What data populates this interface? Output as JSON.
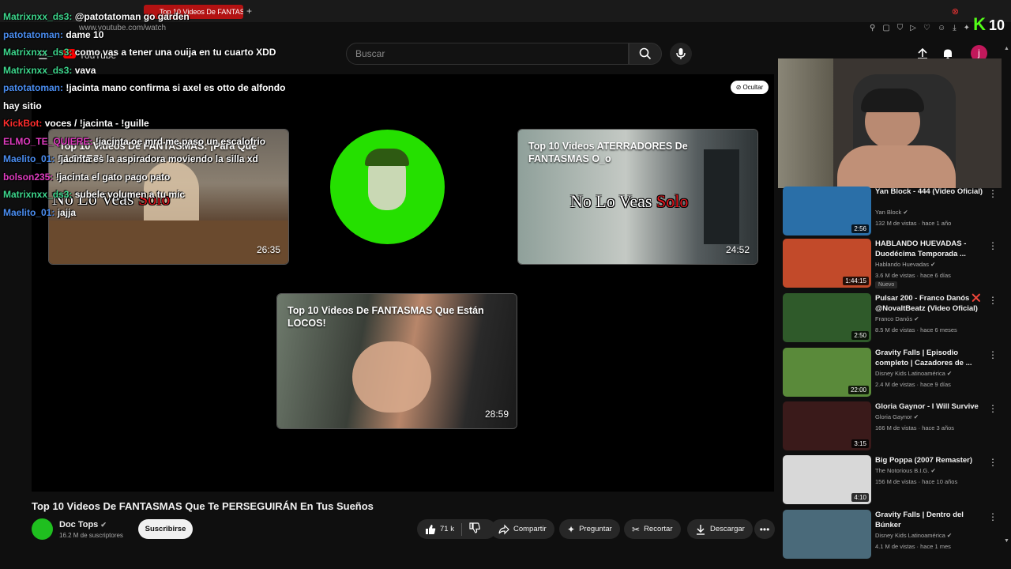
{
  "browser": {
    "tab_title": "Top 10 Videos De FANTASMAS",
    "url": "www.youtube.com/watch",
    "kick_count": "10"
  },
  "header": {
    "logo_text": "YouTube",
    "search_placeholder": "Buscar"
  },
  "player": {
    "hide_label": "Ocultar",
    "cards": [
      {
        "title": "Top 10 Videos De FANTASMAS: ¡Para Que LLORES!",
        "overlay_white": "No Lo Veas",
        "overlay_red": "Solo",
        "duration": "26:35"
      },
      {
        "title": "Top 10 Videos ATERRADORES De FANTASMAS O_o",
        "overlay_white": "No Lo Veas",
        "overlay_red": "Solo",
        "duration": "24:52"
      },
      {
        "title": "Top 10 Videos De FANTASMAS Que Están LOCOS!",
        "duration": "28:59"
      }
    ]
  },
  "video": {
    "title": "Top 10 Videos De FANTASMAS Que Te PERSEGUIRÁN En Tus Sueños",
    "channel": "Doc Tops",
    "subscribers": "16.2 M de suscriptores",
    "subscribe_label": "Suscribirse",
    "likes": "71 k",
    "share_label": "Compartir",
    "ask_label": "Preguntar",
    "clip_label": "Recortar",
    "download_label": "Descargar"
  },
  "recommendations": [
    {
      "title": "Yan Block - 444 (Video Oficial)",
      "channel": "Yan Block",
      "meta": "132 M de vistas · hace 1 año",
      "duration": "2:56",
      "thumb_color": "#2a6fa8"
    },
    {
      "title": "HABLANDO HUEVADAS - Duodécima Temporada ...",
      "channel": "Hablando Huevadas",
      "meta": "3.6 M de vistas · hace 6 días",
      "badge": "Nuevo",
      "duration": "1:44:15",
      "thumb_color": "#c24a2a"
    },
    {
      "title": "Pulsar 200 - Franco Danós ❌ @NovaltBeatz (Video Oficial)",
      "channel": "Franco Danós",
      "meta": "8.5 M de vistas · hace 6 meses",
      "duration": "2:50",
      "thumb_color": "#2f5a2a"
    },
    {
      "title": "Gravity Falls | Episodio completo | Cazadores de ...",
      "channel": "Disney Kids Latinoamérica",
      "meta": "2.4 M de vistas · hace 9 días",
      "duration": "22:00",
      "thumb_color": "#5a8a3a"
    },
    {
      "title": "Gloria Gaynor - I Will Survive",
      "channel": "Gloria Gaynor",
      "meta": "166 M de vistas · hace 3 años",
      "duration": "3:15",
      "thumb_color": "#3a1a1a"
    },
    {
      "title": "Big Poppa (2007 Remaster)",
      "channel": "The Notorious B.I.G.",
      "meta": "156 M de vistas · hace 10 años",
      "duration": "4:10",
      "thumb_color": "#d8d8d8"
    },
    {
      "title": "Gravity Falls | Dentro del Búnker",
      "channel": "Disney Kids Latinoamérica",
      "meta": "4.1 M de vistas · hace 1 mes",
      "duration": "",
      "thumb_color": "#4a6a7a"
    }
  ],
  "chat": [
    {
      "user": "Matrixnxx_ds3:",
      "msg": "@patotatoman go garden",
      "color": "green"
    },
    {
      "user": "patotatoman:",
      "msg": "dame 10",
      "color": "blue"
    },
    {
      "user": "Matrixnxx_ds3:",
      "msg": "como vas a tener una ouija en tu cuarto XDD",
      "color": "green"
    },
    {
      "user": "Matrixnxx_ds3:",
      "msg": "vava",
      "color": "green"
    },
    {
      "user": "patotatoman:",
      "msg": "!jacinta mano confirma si axel es otto de alfondo",
      "color": "blue"
    },
    {
      "user": "",
      "msg": "hay sitio",
      "color": "blue"
    },
    {
      "user": "KickBot:",
      "msg": "voces / !jacinta - !guille",
      "color": "red"
    },
    {
      "user": "ELMO_TE_QUIERE:",
      "msg": "!jacinta oe mrd me paso un escalofrio",
      "color": "pink"
    },
    {
      "user": "Maelito_01:",
      "msg": "!jacinta es la aspiradora moviendo la silla xd",
      "color": "blue"
    },
    {
      "user": "bolson235:",
      "msg": "!jacinta el gato pago pato",
      "color": "pink"
    },
    {
      "user": "Matrixnxx_ds3:",
      "msg": "subele volumen a tu mic",
      "color": "green"
    },
    {
      "user": "Maelito_01:",
      "msg": "jajja",
      "color": "blue"
    }
  ]
}
